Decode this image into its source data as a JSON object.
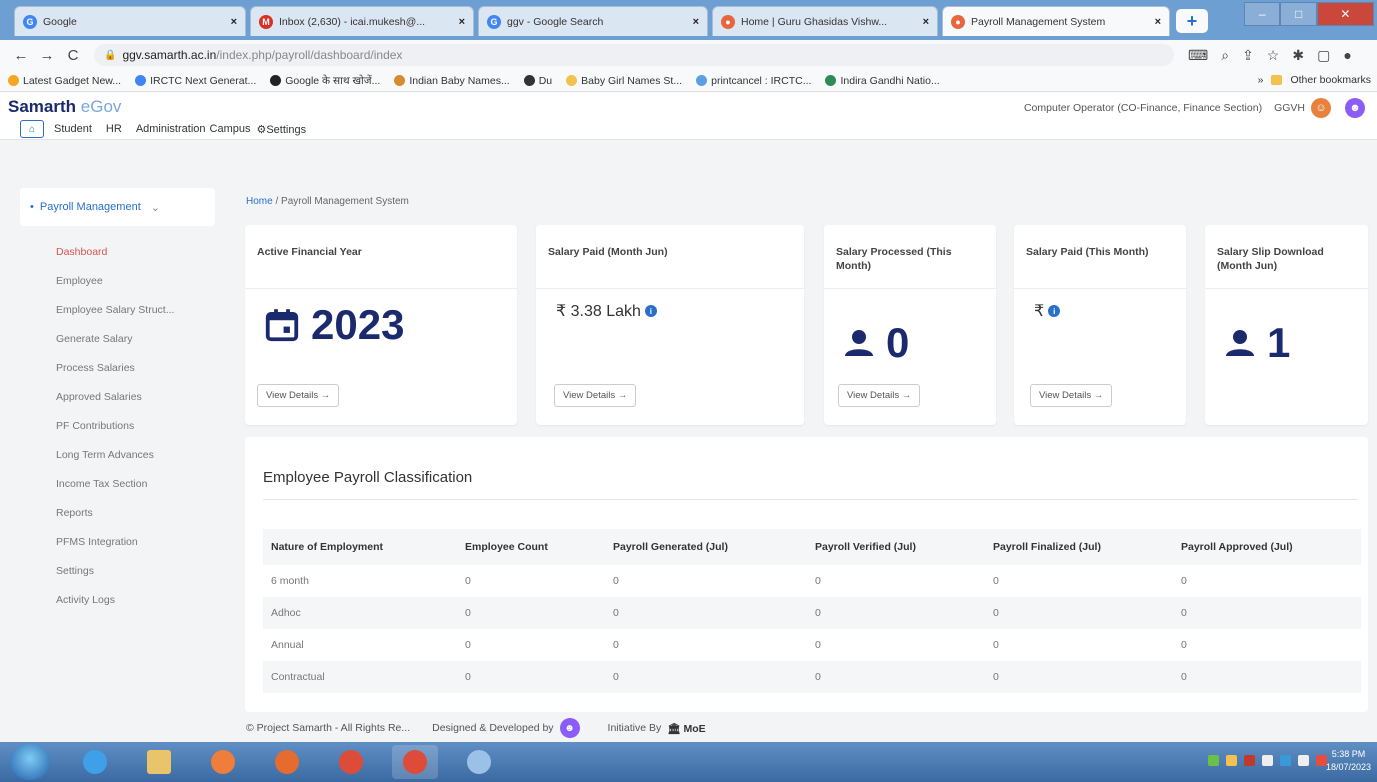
{
  "browser": {
    "tabs": [
      {
        "title": "Google",
        "icon": "google-icon",
        "active": false
      },
      {
        "title": "Inbox (2,630) - icai.mukesh@...",
        "icon": "gmail-icon",
        "active": false
      },
      {
        "title": "ggv - Google Search",
        "icon": "google-icon",
        "active": false
      },
      {
        "title": "Home | Guru Ghasidas Vishw...",
        "icon": "site-icon",
        "active": false
      },
      {
        "title": "Payroll Management System",
        "icon": "site-icon",
        "active": true
      }
    ],
    "url_host": "ggv.samarth.ac.in",
    "url_path": "/index.php/payroll/dashboard/index",
    "bookmarks": [
      "Latest Gadget New...",
      "IRCTC Next Generat...",
      "Google के साथ खोजें...",
      "Indian Baby Names...",
      "Du",
      "Baby Girl Names St...",
      "printcancel : IRCTC...",
      "Indira Gandhi Natio..."
    ],
    "other_bookmarks": "Other bookmarks"
  },
  "app": {
    "brand_main": "Samarth",
    "brand_sub": "eGov",
    "nav": [
      "Student",
      "HR",
      "Administration",
      "Campus",
      "⚙Settings"
    ],
    "user_role": "Computer Operator (CO-Finance, Finance Section)",
    "user_name": "GGVH"
  },
  "sidebar": {
    "header": "Payroll Management",
    "items": [
      {
        "label": "Dashboard",
        "active": true
      },
      {
        "label": "Employee"
      },
      {
        "label": "Employee Salary Struct..."
      },
      {
        "label": "Generate Salary"
      },
      {
        "label": "Process Salaries"
      },
      {
        "label": "Approved Salaries"
      },
      {
        "label": "PF Contributions"
      },
      {
        "label": "Long Term Advances"
      },
      {
        "label": "Income Tax Section"
      },
      {
        "label": "Reports"
      },
      {
        "label": "PFMS Integration"
      },
      {
        "label": "Settings"
      },
      {
        "label": "Activity Logs"
      }
    ]
  },
  "breadcrumb": {
    "home": "Home",
    "sep": "/",
    "current": "Payroll Management System"
  },
  "cards": [
    {
      "title": "Active Financial Year",
      "value": "2023",
      "icon": "calendar-icon",
      "button": "View Details →"
    },
    {
      "title": "Salary Paid (Month Jun)",
      "value": "₹ 3.38 Lakh",
      "icon": "info-icon",
      "button": "View Details →"
    },
    {
      "title": "Salary Processed (This Month)",
      "value": "0",
      "icon": "user-icon",
      "button": "View Details →"
    },
    {
      "title": "Salary Paid (This Month)",
      "value": "₹",
      "icon": "info-icon",
      "button": "View Details →"
    },
    {
      "title": "Salary Slip Download (Month Jun)",
      "value": "1",
      "icon": "user-icon",
      "button": ""
    }
  ],
  "classification": {
    "title": "Employee Payroll Classification",
    "columns": [
      "Nature of Employment",
      "Employee Count",
      "Payroll Generated (Jul)",
      "Payroll Verified (Jul)",
      "Payroll Finalized (Jul)",
      "Payroll Approved (Jul)"
    ],
    "rows": [
      [
        "6 month",
        "0",
        "0",
        "0",
        "0",
        "0"
      ],
      [
        "Adhoc",
        "0",
        "0",
        "0",
        "0",
        "0"
      ],
      [
        "Annual",
        "0",
        "0",
        "0",
        "0",
        "0"
      ],
      [
        "Contractual",
        "0",
        "0",
        "0",
        "0",
        "0"
      ]
    ]
  },
  "footer": {
    "rights": "© Project Samarth - All Rights Re...",
    "designed": "Designed & Developed by",
    "initiative": "Initiative By",
    "moe": "MoE"
  },
  "taskbar": {
    "time": "5:38 PM",
    "date": "18/07/2023"
  },
  "colors": {
    "accent": "#2a6fc9",
    "brand": "#1a2a6c",
    "active_menu": "#d9534f"
  }
}
